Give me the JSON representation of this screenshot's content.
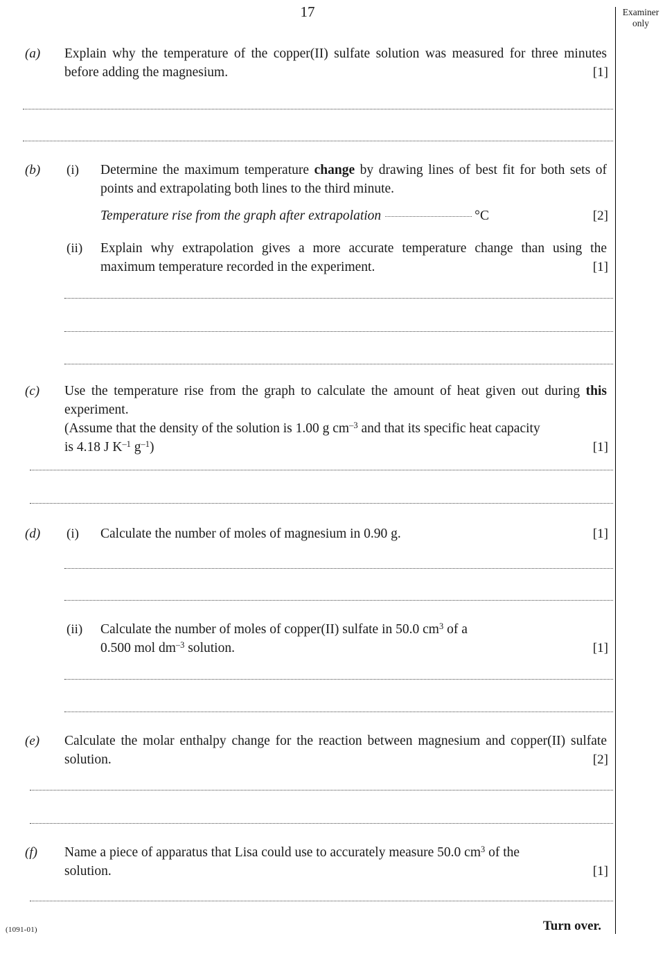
{
  "page": {
    "number": "17",
    "footer_code": "(1091-01)",
    "turn_over": "Turn over."
  },
  "examiner_box": {
    "line1": "Examiner",
    "line2": "only"
  },
  "questions": [
    {
      "marker": "(a)",
      "roman": "",
      "text": "Explain why the temperature of the copper(II) sulfate solution was measured for three minutes before adding the magnesium.",
      "marks": "[1]"
    },
    {
      "marker": "(b)",
      "roman": "(i)",
      "text": "Determine the maximum temperature change by drawing lines of best fit for both sets of points and extrapolating both lines to the third minute.",
      "marks": ""
    },
    {
      "marker": "",
      "roman": "",
      "answer_prompt": "Temperature rise from the graph after extrapolation",
      "answer_unit": "°C",
      "marks": "[2]"
    },
    {
      "marker": "",
      "roman": "(ii)",
      "text": "Explain why extrapolation gives a more accurate temperature change than using the maximum temperature recorded in the experiment.",
      "marks": "[1]"
    },
    {
      "marker": "(c)",
      "roman": "",
      "text": "Use the temperature rise from the graph to calculate the amount of heat given out during this experiment.",
      "assume_line1": "(Assume that the density of the solution is 1.00 g cm",
      "assume_line1_sup": "–3",
      "assume_line1_tail": " and that its specific heat capacity",
      "assume_line2": "is 4.18 J K",
      "assume_line2_sup1": "–1",
      "assume_line2_mid": " g",
      "assume_line2_sup2": "–1",
      "assume_line2_tail": ")",
      "marks": "[1]"
    },
    {
      "marker": "(d)",
      "roman": "(i)",
      "text": "Calculate the number of moles of magnesium in 0.90 g.",
      "marks": "[1]"
    },
    {
      "marker": "",
      "roman": "(ii)",
      "text_a": "Calculate the number of moles of copper(II) sulfate in 50.0 cm",
      "text_a_sup": "3",
      "text_a_tail": " of a",
      "text_b": "0.500 mol dm",
      "text_b_sup": "–3",
      "text_b_tail": " solution.",
      "marks": "[1]"
    },
    {
      "marker": "(e)",
      "roman": "",
      "text": "Calculate the molar enthalpy change for the reaction between magnesium and copper(II) sulfate solution.",
      "marks": "[2]"
    },
    {
      "marker": "(f)",
      "roman": "",
      "text_a": "Name a piece of apparatus that Lisa could use to accurately measure 50.0 cm",
      "text_a_sup": "3",
      "text_a_tail": " of the",
      "text_b": "solution.",
      "marks": "[1]"
    }
  ],
  "bold_words": {
    "change": "change",
    "this": "this"
  }
}
